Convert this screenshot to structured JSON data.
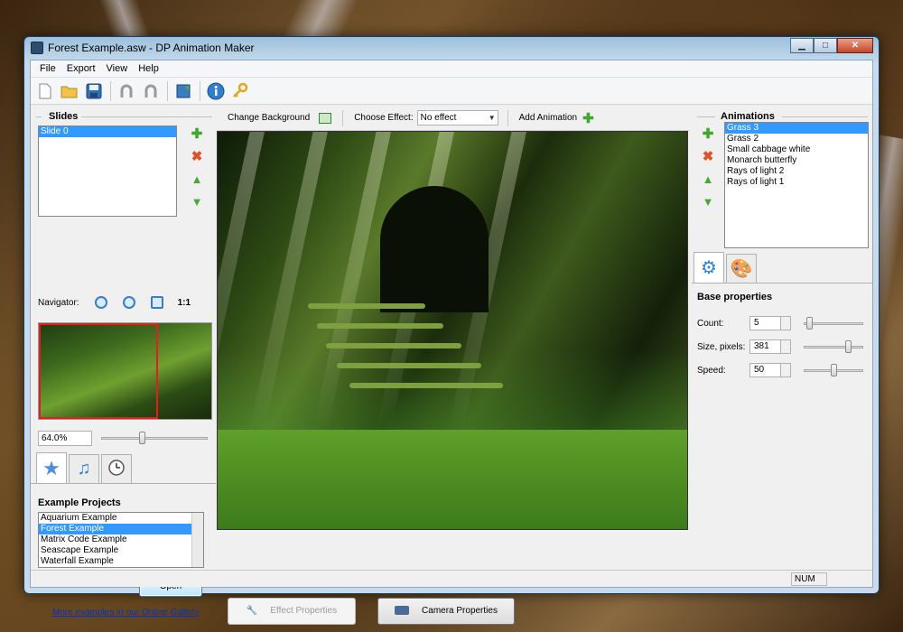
{
  "window": {
    "title": "Forest Example.asw - DP Animation Maker"
  },
  "menu": [
    "File",
    "Export",
    "View",
    "Help"
  ],
  "toolbar": {
    "icons": [
      "new-file-icon",
      "open-folder-icon",
      "save-icon",
      "undo-icon",
      "redo-icon",
      "export-video-icon",
      "info-icon",
      "key-icon"
    ]
  },
  "slides": {
    "title": "Slides",
    "items": [
      "Slide 0"
    ],
    "selected": 0
  },
  "navigator": {
    "label": "Navigator:",
    "actual_size_label": "1:1",
    "zoom": "64.0%",
    "zoom_level": 0.38
  },
  "left_tabs": [
    "star-tab-icon",
    "music-tab-icon",
    "clock-tab-icon"
  ],
  "examples": {
    "title": "Example Projects",
    "items": [
      "Aquarium Example",
      "Forest Example",
      "Matrix Code Example",
      "Seascape Example",
      "Waterfall Example"
    ],
    "selected": 1,
    "open_label": "Open",
    "gallery_link": "More examples in our Online Gallery"
  },
  "center_toolbar": {
    "change_background": "Change Background",
    "choose_effect": "Choose Effect:",
    "effect_value": "No effect",
    "add_animation": "Add Animation"
  },
  "bottom_buttons": {
    "effect_properties": "Effect Properties",
    "camera_properties": "Camera Properties"
  },
  "animations": {
    "title": "Animations",
    "items": [
      "Grass 3",
      "Grass 2",
      "Small cabbage white",
      "Monarch butterfly",
      "Rays of light 2",
      "Rays of light 1"
    ],
    "selected": 0
  },
  "properties": {
    "title": "Base properties",
    "count_label": "Count:",
    "count_value": "5",
    "count_level": 0.05,
    "size_label": "Size, pixels:",
    "size_value": "381",
    "size_level": 0.78,
    "speed_label": "Speed:",
    "speed_value": "50",
    "speed_level": 0.5
  },
  "status": {
    "num": "NUM"
  },
  "colors": {
    "selection": "#3399ff",
    "accent_green": "#3ea82b",
    "delete_red": "#e0512a"
  }
}
